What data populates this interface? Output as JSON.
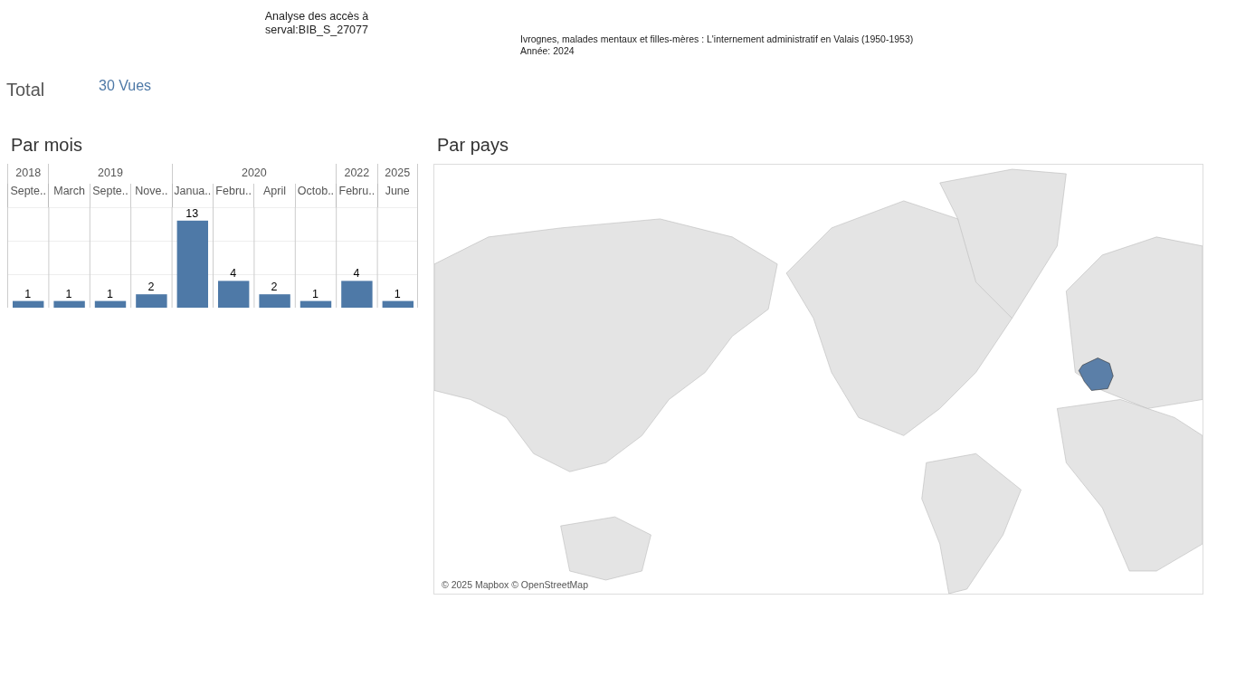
{
  "header": {
    "title_lines": [
      "Analyse des accès à",
      "serval:BIB_S_27077"
    ],
    "document_title": "Ivrognes, malades mentaux et filles-mères : L'internement administratif en Valais (1950-1953)",
    "year": "Année: 2024"
  },
  "total": {
    "label": "Total",
    "value": "30 Vues"
  },
  "by_month": {
    "title": "Par mois",
    "column_years": [
      {
        "starts_year": true,
        "year": "2018"
      },
      {
        "starts_year": true,
        "year": "2019"
      },
      {
        "starts_year": false
      },
      {
        "starts_year": false
      },
      {
        "starts_year": true,
        "year": "2020"
      },
      {
        "starts_year": false
      },
      {
        "starts_year": false
      },
      {
        "starts_year": false
      },
      {
        "starts_year": true,
        "year": "2022"
      },
      {
        "starts_year": true,
        "year": "2025"
      }
    ],
    "chart_data": {
      "type": "bar",
      "categories": [
        "Septe..",
        "March",
        "Septe..",
        "Nove..",
        "Janua..",
        "Febru..",
        "April",
        "Octob..",
        "Febru..",
        "June"
      ],
      "values": [
        1,
        1,
        1,
        2,
        13,
        4,
        2,
        1,
        4,
        1
      ],
      "data_labels": true
    }
  },
  "by_country": {
    "title": "Par pays",
    "attribution": "© 2025 Mapbox © OpenStreetMap"
  }
}
